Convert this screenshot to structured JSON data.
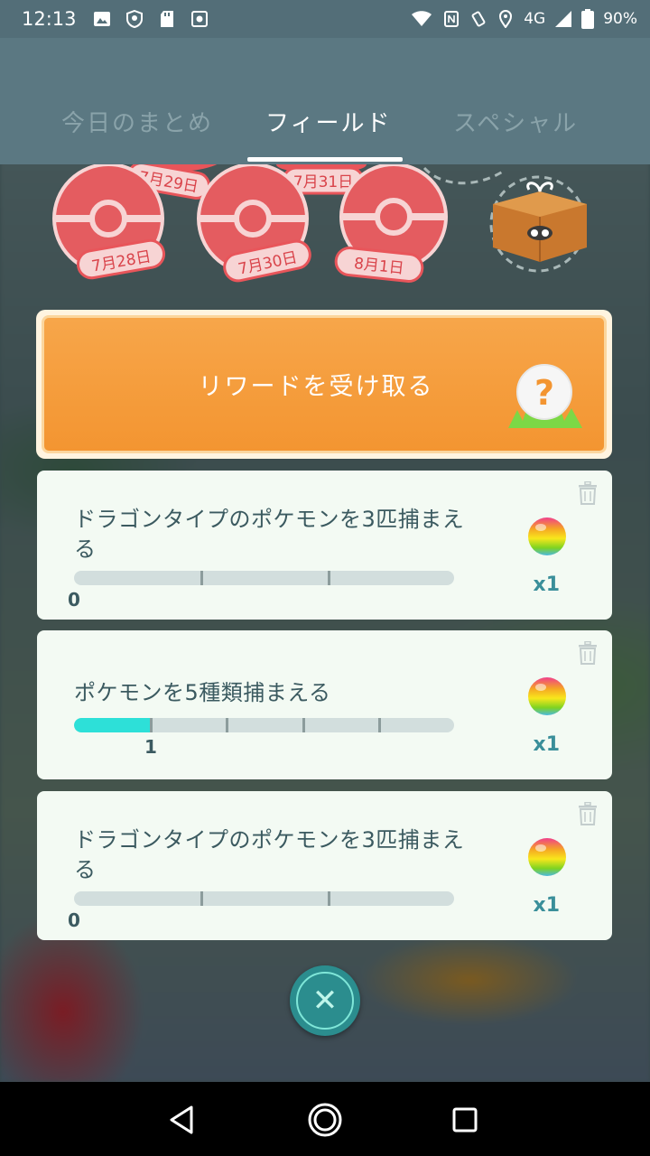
{
  "status_bar": {
    "time": "12:13",
    "network": "4G",
    "battery": "90%",
    "left_icons": [
      "image-icon",
      "shield-icon",
      "sd-card-icon",
      "settings-icon"
    ],
    "right_icons": [
      "wifi-icon",
      "nfc-icon",
      "vibrate-icon",
      "location-icon",
      "signal-icon",
      "battery-icon"
    ]
  },
  "tabs": [
    {
      "label": "今日のまとめ",
      "active": false
    },
    {
      "label": "フィールド",
      "active": true
    },
    {
      "label": "スペシャル",
      "active": false
    }
  ],
  "stamps": [
    {
      "label": "7月28日"
    },
    {
      "label": "7月29日"
    },
    {
      "label": "7月30日"
    },
    {
      "label": "7月31日"
    },
    {
      "label": "8月1日"
    }
  ],
  "reward_button": {
    "label": "リワードを受け取る",
    "icon": "mystery-reward-icon"
  },
  "tasks": [
    {
      "title": "ドラゴンタイプのポケモンを3匹捕まえる",
      "progress_value": "0",
      "progress_fraction": 0.0,
      "segments": 3,
      "reward_item": "berry-icon",
      "reward_qty": "x1"
    },
    {
      "title": "ポケモンを5種類捕まえる",
      "progress_value": "1",
      "progress_fraction": 0.2,
      "segments": 5,
      "reward_item": "berry-icon",
      "reward_qty": "x1"
    },
    {
      "title": "ドラゴンタイプのポケモンを3匹捕まえる",
      "progress_value": "0",
      "progress_fraction": 0.0,
      "segments": 3,
      "reward_item": "berry-icon",
      "reward_qty": "x1"
    }
  ],
  "colors": {
    "header": "#5b7882",
    "reward_orange": "#f39531",
    "progress_fill": "#2de0d8",
    "close_button": "#2b8d8e"
  }
}
